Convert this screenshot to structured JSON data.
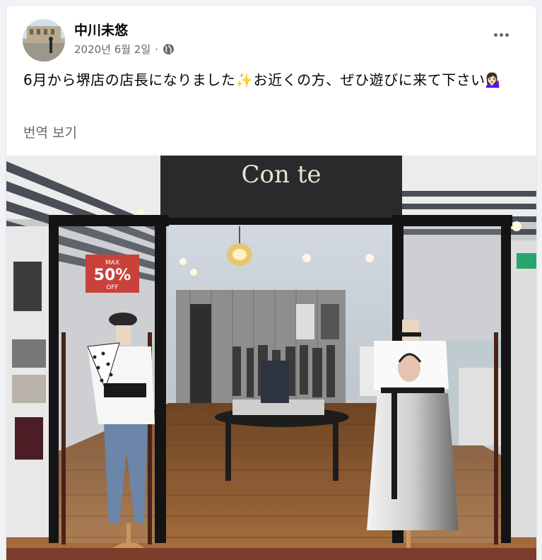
{
  "post": {
    "author": "中川未悠",
    "date": "2020년 6월 2일",
    "separator": "·",
    "privacy_icon": "globe-icon",
    "more_icon": "more-horizontal-icon",
    "text": "6月から堺店の店長になりました✨お近くの方、ぜひ遊びに来て下さい💁🏻‍♀️",
    "translate_label": "번역 보기"
  },
  "photo": {
    "store_sign": "Con te",
    "sale_sign": {
      "top": "MAX",
      "main": "50%",
      "bottom": "OFF"
    }
  },
  "colors": {
    "meta_gray": "#65676b",
    "sale_red": "#c8413a",
    "floor_wood": "#8a5a33",
    "background": "#f0f2f5"
  }
}
